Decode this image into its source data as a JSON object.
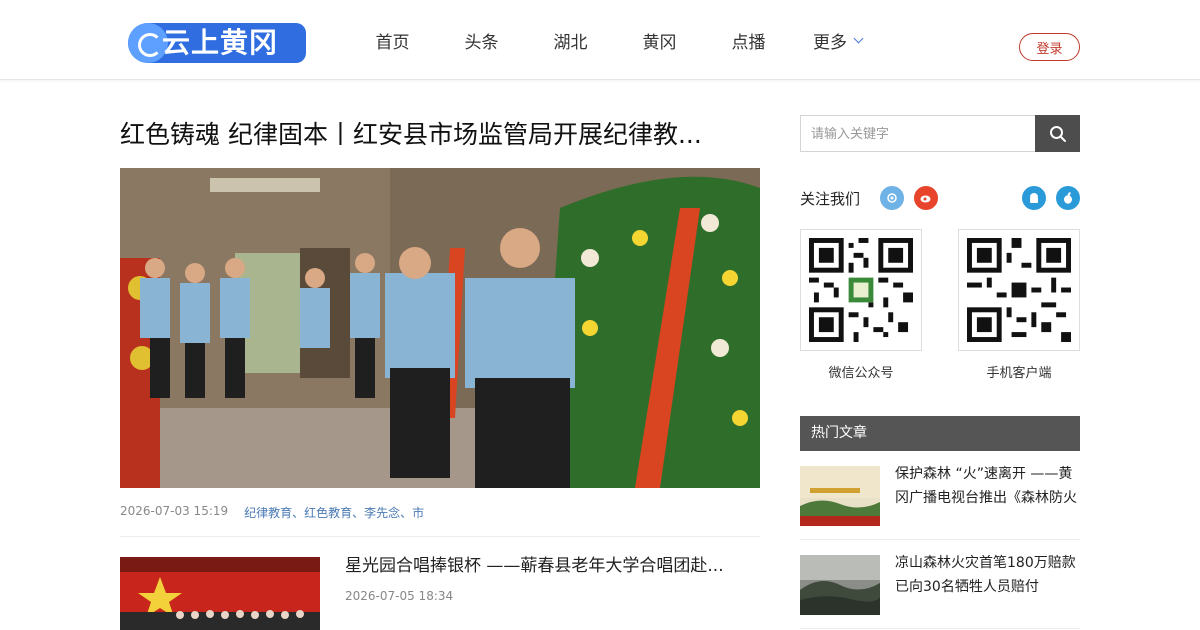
{
  "header": {
    "logo_text": "云上黄冈",
    "nav": [
      "首页",
      "头条",
      "湖北",
      "黄冈",
      "点播"
    ],
    "more_label": "更多",
    "login_label": "登录"
  },
  "article": {
    "title": "红色铸魂 纪律固本丨红安县市场监管局开展纪律教...",
    "date": "2026-07-03 15:19",
    "tags": "纪律教育、红色教育、李先念、市"
  },
  "second_item": {
    "title": "星光园合唱捧银杯 ——蕲春县老年大学合唱团赴...",
    "date": "2026-07-05 18:34"
  },
  "sidebar": {
    "search_placeholder": "请输入关键字",
    "follow_label": "关注我们",
    "qr": [
      {
        "label": "微信公众号"
      },
      {
        "label": "手机客户端"
      }
    ],
    "hot_title": "热门文章",
    "hot_articles": [
      {
        "title": "保护森林 “火”速离开 ——黄冈广播电视台推出《森林防火"
      },
      {
        "title": "凉山森林火灾首笔180万赔款已向30名牺牲人员赔付"
      }
    ]
  },
  "colors": {
    "accent_blue": "#2f6de1",
    "login_red": "#c0392b",
    "tag_blue": "#4a7ab4",
    "dark_gray": "#4d4d4d"
  }
}
